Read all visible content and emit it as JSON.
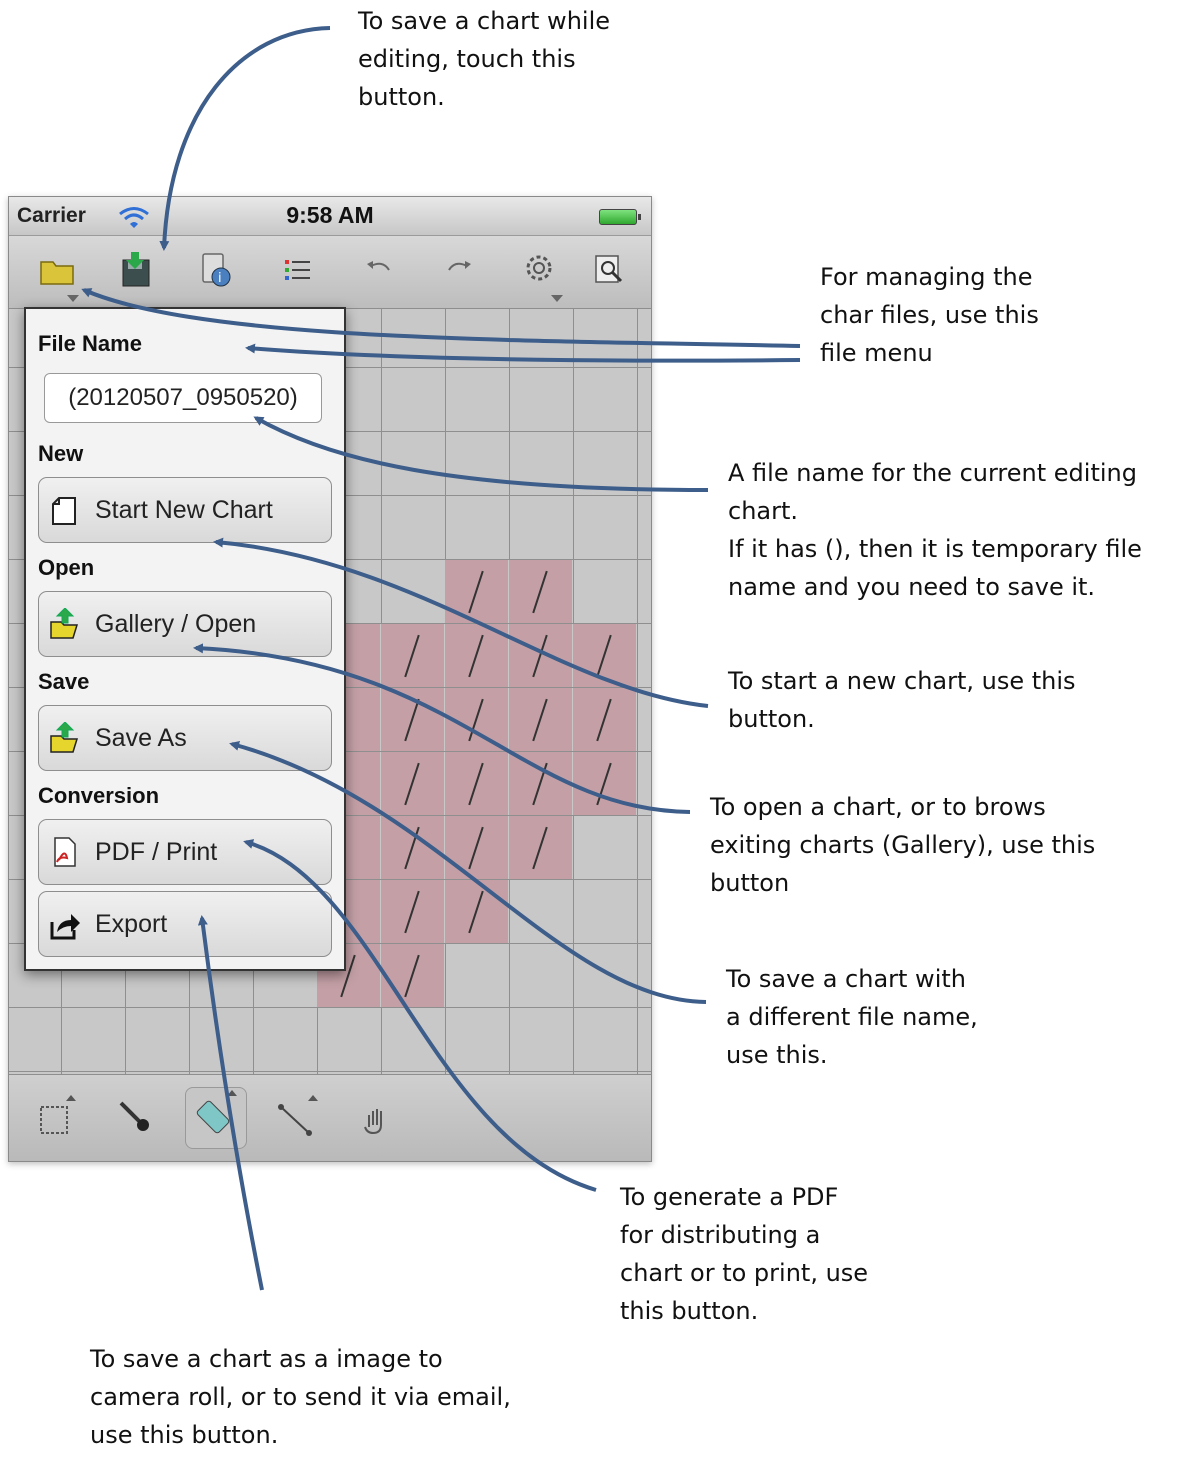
{
  "annotations": {
    "save_while_editing": "To save a chart while\nediting, touch this\nbutton.",
    "file_menu": "For managing the\nchar files, use this\nfile menu",
    "file_name": "A file name for the current editing\nchart.\nIf it has (), then it is temporary file\nname and you need to save it.",
    "start_new": "To start a new chart, use this\nbutton.",
    "open": "To open a chart, or to brows\nexiting charts (Gallery), use this\nbutton",
    "save_as": "To save a chart with\na different file name,\nuse this.",
    "pdf": "To generate a PDF\nfor distributing a\nchart or to print, use\nthis button.",
    "export": "To save a chart as a image to\ncamera roll, or to send it via email,\nuse this button."
  },
  "status_bar": {
    "carrier": "Carrier",
    "time": "9:58 AM"
  },
  "toolbar": {
    "icons": [
      "folder-icon",
      "save-icon",
      "info-icon",
      "list-icon",
      "undo-icon",
      "redo-icon",
      "settings-icon",
      "zoom-icon"
    ]
  },
  "menu": {
    "file_name_header": "File Name",
    "file_name_value": "(20120507_0950520)",
    "new_header": "New",
    "start_new_label": "Start New Chart",
    "open_header": "Open",
    "gallery_label": "Gallery / Open",
    "save_header": "Save",
    "save_as_label": "Save As",
    "conversion_header": "Conversion",
    "pdf_label": "PDF / Print",
    "export_label": "Export"
  },
  "bottom_tools": [
    "select-icon",
    "picker-icon",
    "eraser-icon",
    "line-icon",
    "hand-icon"
  ],
  "colors": {
    "arrow": "#3d5d8a",
    "highlight_cell": "#c4a0a6"
  }
}
